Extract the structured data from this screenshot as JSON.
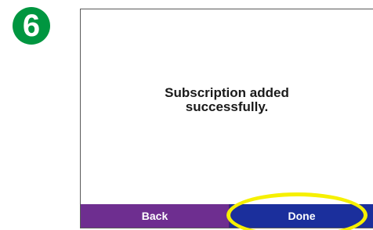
{
  "step": {
    "number": "6",
    "color": "#009640"
  },
  "dialog": {
    "message_line1": "Subscription added",
    "message_line2": "successfully."
  },
  "buttons": {
    "back_label": "Back",
    "done_label": "Done"
  },
  "highlight": {
    "target": "done-button",
    "color": "#f6f000"
  },
  "colors": {
    "button_bar_purple": "#6e2e90",
    "done_blue": "#1b2f9c"
  }
}
